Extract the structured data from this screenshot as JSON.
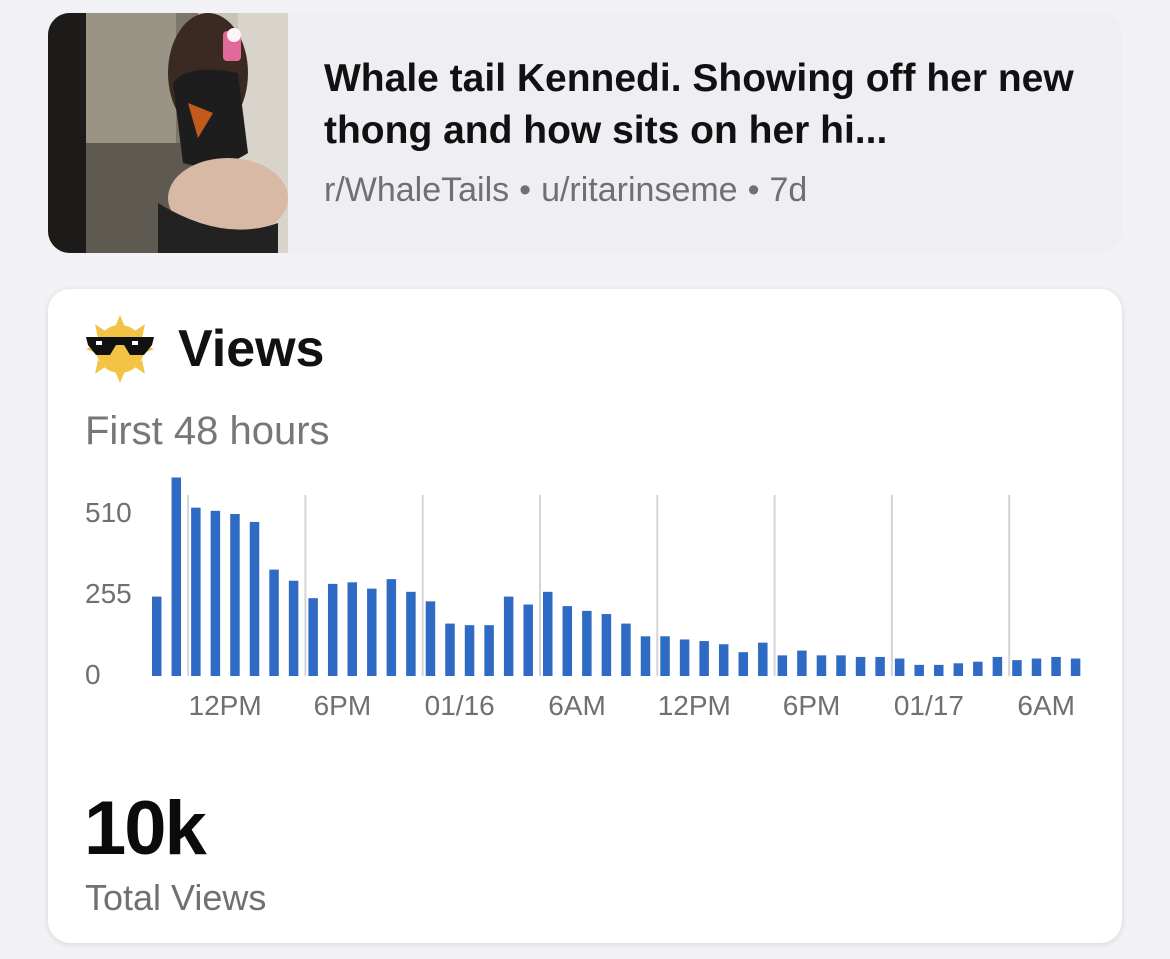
{
  "post": {
    "title": "Whale tail Kennedi. Showing off her new thong and how sits on her hi...",
    "subreddit": "r/WhaleTails",
    "user": "u/ritarinseme",
    "age": "7d",
    "separator": "•"
  },
  "views": {
    "title": "Views",
    "icon": "sunglasses-sun-icon",
    "subtitle": "First 48 hours",
    "total_value": "10k",
    "total_label": "Total Views"
  },
  "colors": {
    "bar": "#2f6bc4",
    "grid": "#d4d4d8",
    "tick": "#6f6f74"
  },
  "chart_data": {
    "type": "bar",
    "yticks": [
      510,
      255,
      0
    ],
    "ylim": [
      0,
      510
    ],
    "xlabels": [
      "12PM",
      "6PM",
      "01/16",
      "6AM",
      "12PM",
      "6PM",
      "01/17",
      "6AM"
    ],
    "grid": "vertical",
    "values": [
      250,
      625,
      530,
      520,
      510,
      485,
      335,
      300,
      245,
      290,
      295,
      275,
      305,
      265,
      235,
      165,
      160,
      160,
      250,
      225,
      265,
      220,
      205,
      195,
      165,
      125,
      125,
      115,
      110,
      100,
      75,
      105,
      65,
      80,
      65,
      65,
      60,
      60,
      55,
      35,
      35,
      40,
      45,
      60,
      50,
      55,
      60,
      55
    ]
  }
}
